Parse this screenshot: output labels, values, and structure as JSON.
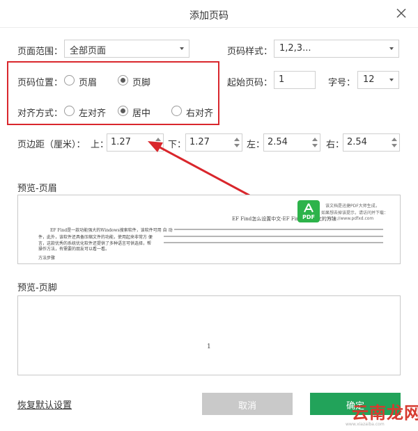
{
  "dialog": {
    "title": "添加页码"
  },
  "range": {
    "label": "页面范围：",
    "value": "全部页面"
  },
  "style": {
    "label": "页码样式：",
    "value": "1,2,3..."
  },
  "position": {
    "label": "页码位置：",
    "options": [
      "页眉",
      "页脚"
    ],
    "selected": "页脚"
  },
  "align": {
    "label": "对齐方式：",
    "options": [
      "左对齐",
      "居中",
      "右对齐"
    ],
    "selected": "居中"
  },
  "start": {
    "label": "起始页码：",
    "value": "1"
  },
  "fontsize": {
    "label": "字号：",
    "value": "12"
  },
  "margins": {
    "label": "页边距（厘米）：",
    "top_label": "上：",
    "top": "1.27",
    "bottom_label": "下：",
    "bottom": "1.27",
    "left_label": "左：",
    "left": "2.54",
    "right_label": "右：",
    "right": "2.54"
  },
  "preview_header": {
    "label": "预览-页眉",
    "doc_title": "EF Find怎么设置中文-EF Find设置中文的方法",
    "para_lead": "EF Find是一款功能强大的Windows搜索软件，该软件可用 自 动",
    "para_line2": "件，此外，该软件还具备压缩文件的功能，使用起来非常方 便",
    "para_line3": "言，这款优秀的系统优化软件还提供了多种语言可供选择，帮",
    "para_line4": "操作方法，有需要的朋友可以看一看。",
    "method": "方法步骤"
  },
  "watermark": {
    "logo_text": "PDF",
    "line1": "该文档是迅捷PDF大师生成，",
    "line2": "如果想去掉该提示，请访问并下载：",
    "line3": "http://www.pdfxd.com"
  },
  "preview_footer": {
    "label": "预览-页脚",
    "page_number": "1"
  },
  "actions": {
    "reset": "恢复默认设置",
    "cancel": "取消",
    "ok": "确定"
  },
  "site_watermark": {
    "text": "云南龙网",
    "small": "www.xiazaiba.com"
  },
  "colors": {
    "accent_green": "#22a35a",
    "highlight_red": "#d9262c",
    "disabled_gray": "#c9c9c9"
  },
  "icons": {
    "close": "close-icon",
    "arrow": "red-arrow-annotation"
  }
}
